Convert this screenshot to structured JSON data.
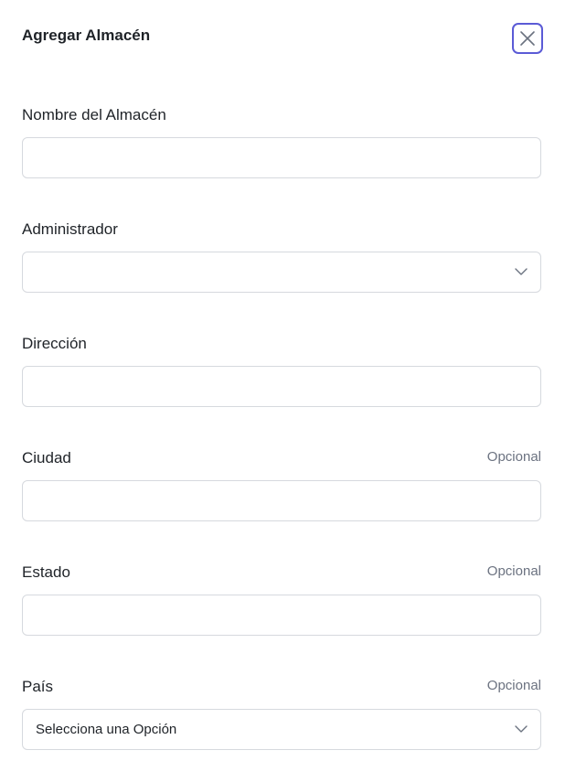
{
  "modal": {
    "title": "Agregar Almacén",
    "close_icon": "close-icon"
  },
  "fields": [
    {
      "label": "Nombre del Almacén",
      "type": "text",
      "value": "",
      "optional_label": ""
    },
    {
      "label": "Administrador",
      "type": "select",
      "value": "",
      "optional_label": ""
    },
    {
      "label": "Dirección",
      "type": "text",
      "value": "",
      "optional_label": ""
    },
    {
      "label": "Ciudad",
      "type": "text",
      "value": "",
      "optional_label": "Opcional"
    },
    {
      "label": "Estado",
      "type": "text",
      "value": "",
      "optional_label": "Opcional"
    },
    {
      "label": "País",
      "type": "select",
      "value": "Selecciona una Opción",
      "optional_label": "Opcional"
    }
  ],
  "colors": {
    "accent": "#5b5bd6",
    "border": "#d6d9de",
    "muted": "#6b7280",
    "text": "#1f2328"
  }
}
